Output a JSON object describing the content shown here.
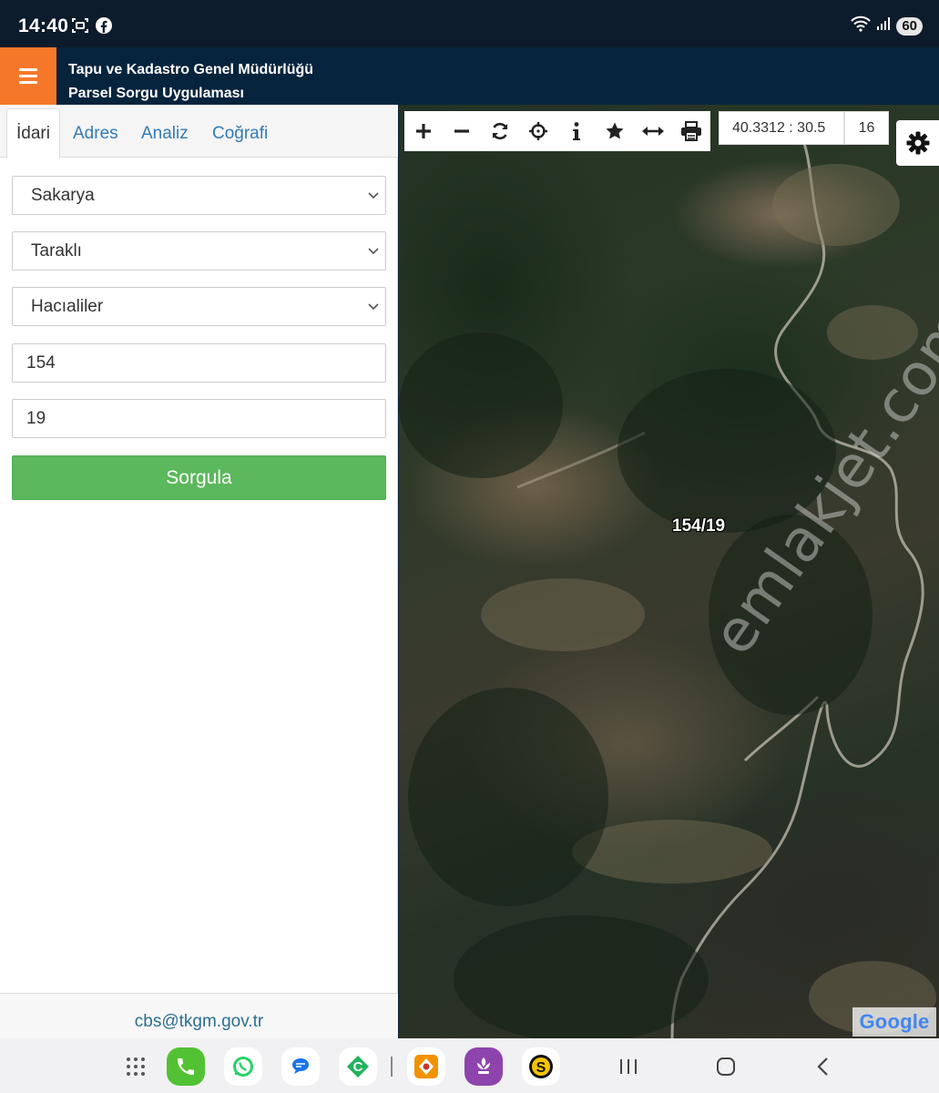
{
  "status_bar": {
    "time": "14:40",
    "battery": "60",
    "left_icons": [
      "screenshot-icon",
      "facebook-icon"
    ],
    "right_icons": [
      "wifi-icon",
      "signal-icon"
    ]
  },
  "app": {
    "title_line1": "Tapu ve Kadastro Genel Müdürlüğü",
    "title_line2": "Parsel Sorgu Uygulaması",
    "accent_color": "#f5782a",
    "header_color": "#07243d"
  },
  "tabs": [
    {
      "label": "İdari",
      "active": true
    },
    {
      "label": "Adres",
      "active": false
    },
    {
      "label": "Analiz",
      "active": false
    },
    {
      "label": "Coğrafi",
      "active": false
    }
  ],
  "form": {
    "il": "Sakarya",
    "ilce": "Taraklı",
    "mahalle": "Hacıaliler",
    "ada": "154",
    "parsel": "19",
    "submit_label": "Sorgula",
    "submit_color": "#5cb85c"
  },
  "footer": {
    "email": "cbs@tkgm.gov.tr"
  },
  "map": {
    "toolbar": [
      "zoom-in-icon",
      "zoom-out-icon",
      "refresh-icon",
      "locate-icon",
      "info-icon",
      "star-icon",
      "measure-icon",
      "print-icon"
    ],
    "coordinates": "40.3312 : 30.5",
    "zoom_level": "16",
    "parcel_label": "154/19",
    "attribution": "Google",
    "watermark": "emlakjet.com"
  },
  "nav_bar": {
    "apps": [
      "apps-grid-icon",
      "phone-app-icon",
      "whatsapp-app-icon",
      "messages-app-icon",
      "c-app-icon",
      "orange-app-icon",
      "purple-app-icon",
      "s-app-icon"
    ],
    "buttons": [
      "recents-icon",
      "home-icon",
      "back-icon"
    ]
  }
}
